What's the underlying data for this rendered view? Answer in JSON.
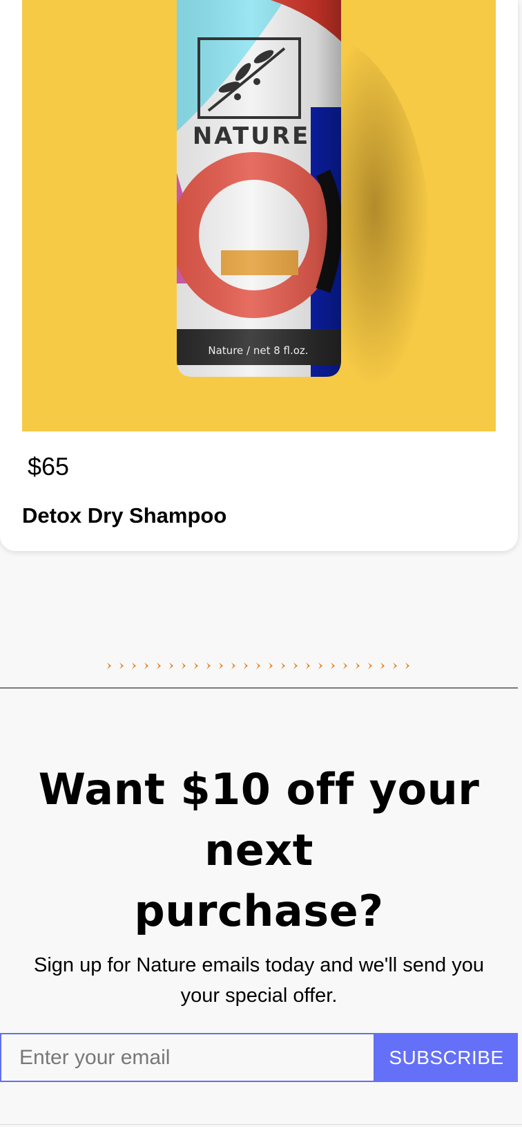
{
  "product": {
    "image_alt": "Nature dry shampoo bottle on yellow background",
    "image_brand_text": "NATURE",
    "image_label_text": "Nature / net 8 fl.oz.",
    "price": "$65",
    "name": "Detox Dry Shampoo"
  },
  "divider": {
    "icon": "chevron-icon",
    "count": 25,
    "color": "#e8862a"
  },
  "offer": {
    "title_line1": "Want $10 off your next",
    "title_line2": "purchase?",
    "description": "Sign up for Nature emails today and we'll send you your special offer."
  },
  "subscribe": {
    "email_placeholder": "Enter your email",
    "button_label": "SUBSCRIBE"
  },
  "colors": {
    "image_background": "#f6ca45",
    "accent": "#6470f7"
  }
}
